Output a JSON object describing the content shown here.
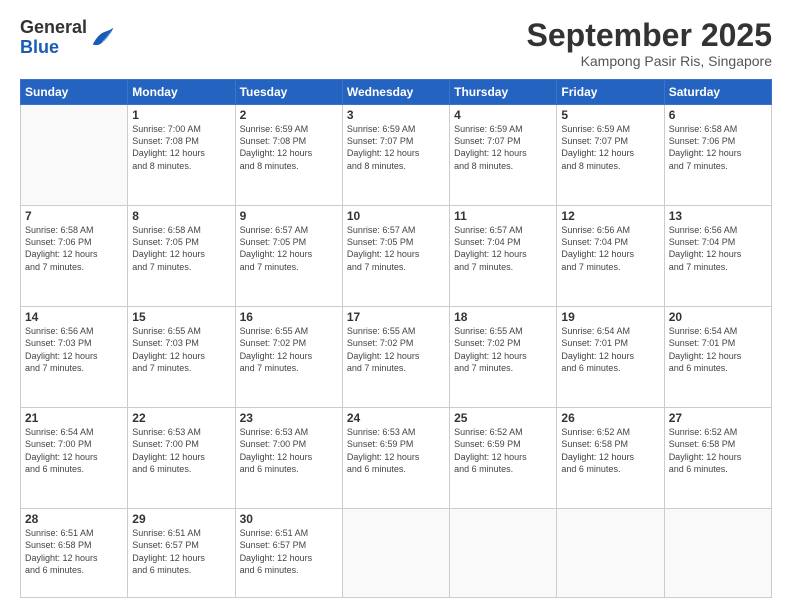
{
  "header": {
    "logo": {
      "line1": "General",
      "line2": "Blue"
    },
    "title": "September 2025",
    "location": "Kampong Pasir Ris, Singapore"
  },
  "days_of_week": [
    "Sunday",
    "Monday",
    "Tuesday",
    "Wednesday",
    "Thursday",
    "Friday",
    "Saturday"
  ],
  "weeks": [
    [
      {
        "day": "",
        "info": ""
      },
      {
        "day": "1",
        "info": "Sunrise: 7:00 AM\nSunset: 7:08 PM\nDaylight: 12 hours\nand 8 minutes."
      },
      {
        "day": "2",
        "info": "Sunrise: 6:59 AM\nSunset: 7:08 PM\nDaylight: 12 hours\nand 8 minutes."
      },
      {
        "day": "3",
        "info": "Sunrise: 6:59 AM\nSunset: 7:07 PM\nDaylight: 12 hours\nand 8 minutes."
      },
      {
        "day": "4",
        "info": "Sunrise: 6:59 AM\nSunset: 7:07 PM\nDaylight: 12 hours\nand 8 minutes."
      },
      {
        "day": "5",
        "info": "Sunrise: 6:59 AM\nSunset: 7:07 PM\nDaylight: 12 hours\nand 8 minutes."
      },
      {
        "day": "6",
        "info": "Sunrise: 6:58 AM\nSunset: 7:06 PM\nDaylight: 12 hours\nand 7 minutes."
      }
    ],
    [
      {
        "day": "7",
        "info": "Sunrise: 6:58 AM\nSunset: 7:06 PM\nDaylight: 12 hours\nand 7 minutes."
      },
      {
        "day": "8",
        "info": "Sunrise: 6:58 AM\nSunset: 7:05 PM\nDaylight: 12 hours\nand 7 minutes."
      },
      {
        "day": "9",
        "info": "Sunrise: 6:57 AM\nSunset: 7:05 PM\nDaylight: 12 hours\nand 7 minutes."
      },
      {
        "day": "10",
        "info": "Sunrise: 6:57 AM\nSunset: 7:05 PM\nDaylight: 12 hours\nand 7 minutes."
      },
      {
        "day": "11",
        "info": "Sunrise: 6:57 AM\nSunset: 7:04 PM\nDaylight: 12 hours\nand 7 minutes."
      },
      {
        "day": "12",
        "info": "Sunrise: 6:56 AM\nSunset: 7:04 PM\nDaylight: 12 hours\nand 7 minutes."
      },
      {
        "day": "13",
        "info": "Sunrise: 6:56 AM\nSunset: 7:04 PM\nDaylight: 12 hours\nand 7 minutes."
      }
    ],
    [
      {
        "day": "14",
        "info": "Sunrise: 6:56 AM\nSunset: 7:03 PM\nDaylight: 12 hours\nand 7 minutes."
      },
      {
        "day": "15",
        "info": "Sunrise: 6:55 AM\nSunset: 7:03 PM\nDaylight: 12 hours\nand 7 minutes."
      },
      {
        "day": "16",
        "info": "Sunrise: 6:55 AM\nSunset: 7:02 PM\nDaylight: 12 hours\nand 7 minutes."
      },
      {
        "day": "17",
        "info": "Sunrise: 6:55 AM\nSunset: 7:02 PM\nDaylight: 12 hours\nand 7 minutes."
      },
      {
        "day": "18",
        "info": "Sunrise: 6:55 AM\nSunset: 7:02 PM\nDaylight: 12 hours\nand 7 minutes."
      },
      {
        "day": "19",
        "info": "Sunrise: 6:54 AM\nSunset: 7:01 PM\nDaylight: 12 hours\nand 6 minutes."
      },
      {
        "day": "20",
        "info": "Sunrise: 6:54 AM\nSunset: 7:01 PM\nDaylight: 12 hours\nand 6 minutes."
      }
    ],
    [
      {
        "day": "21",
        "info": "Sunrise: 6:54 AM\nSunset: 7:00 PM\nDaylight: 12 hours\nand 6 minutes."
      },
      {
        "day": "22",
        "info": "Sunrise: 6:53 AM\nSunset: 7:00 PM\nDaylight: 12 hours\nand 6 minutes."
      },
      {
        "day": "23",
        "info": "Sunrise: 6:53 AM\nSunset: 7:00 PM\nDaylight: 12 hours\nand 6 minutes."
      },
      {
        "day": "24",
        "info": "Sunrise: 6:53 AM\nSunset: 6:59 PM\nDaylight: 12 hours\nand 6 minutes."
      },
      {
        "day": "25",
        "info": "Sunrise: 6:52 AM\nSunset: 6:59 PM\nDaylight: 12 hours\nand 6 minutes."
      },
      {
        "day": "26",
        "info": "Sunrise: 6:52 AM\nSunset: 6:58 PM\nDaylight: 12 hours\nand 6 minutes."
      },
      {
        "day": "27",
        "info": "Sunrise: 6:52 AM\nSunset: 6:58 PM\nDaylight: 12 hours\nand 6 minutes."
      }
    ],
    [
      {
        "day": "28",
        "info": "Sunrise: 6:51 AM\nSunset: 6:58 PM\nDaylight: 12 hours\nand 6 minutes."
      },
      {
        "day": "29",
        "info": "Sunrise: 6:51 AM\nSunset: 6:57 PM\nDaylight: 12 hours\nand 6 minutes."
      },
      {
        "day": "30",
        "info": "Sunrise: 6:51 AM\nSunset: 6:57 PM\nDaylight: 12 hours\nand 6 minutes."
      },
      {
        "day": "",
        "info": ""
      },
      {
        "day": "",
        "info": ""
      },
      {
        "day": "",
        "info": ""
      },
      {
        "day": "",
        "info": ""
      }
    ]
  ]
}
